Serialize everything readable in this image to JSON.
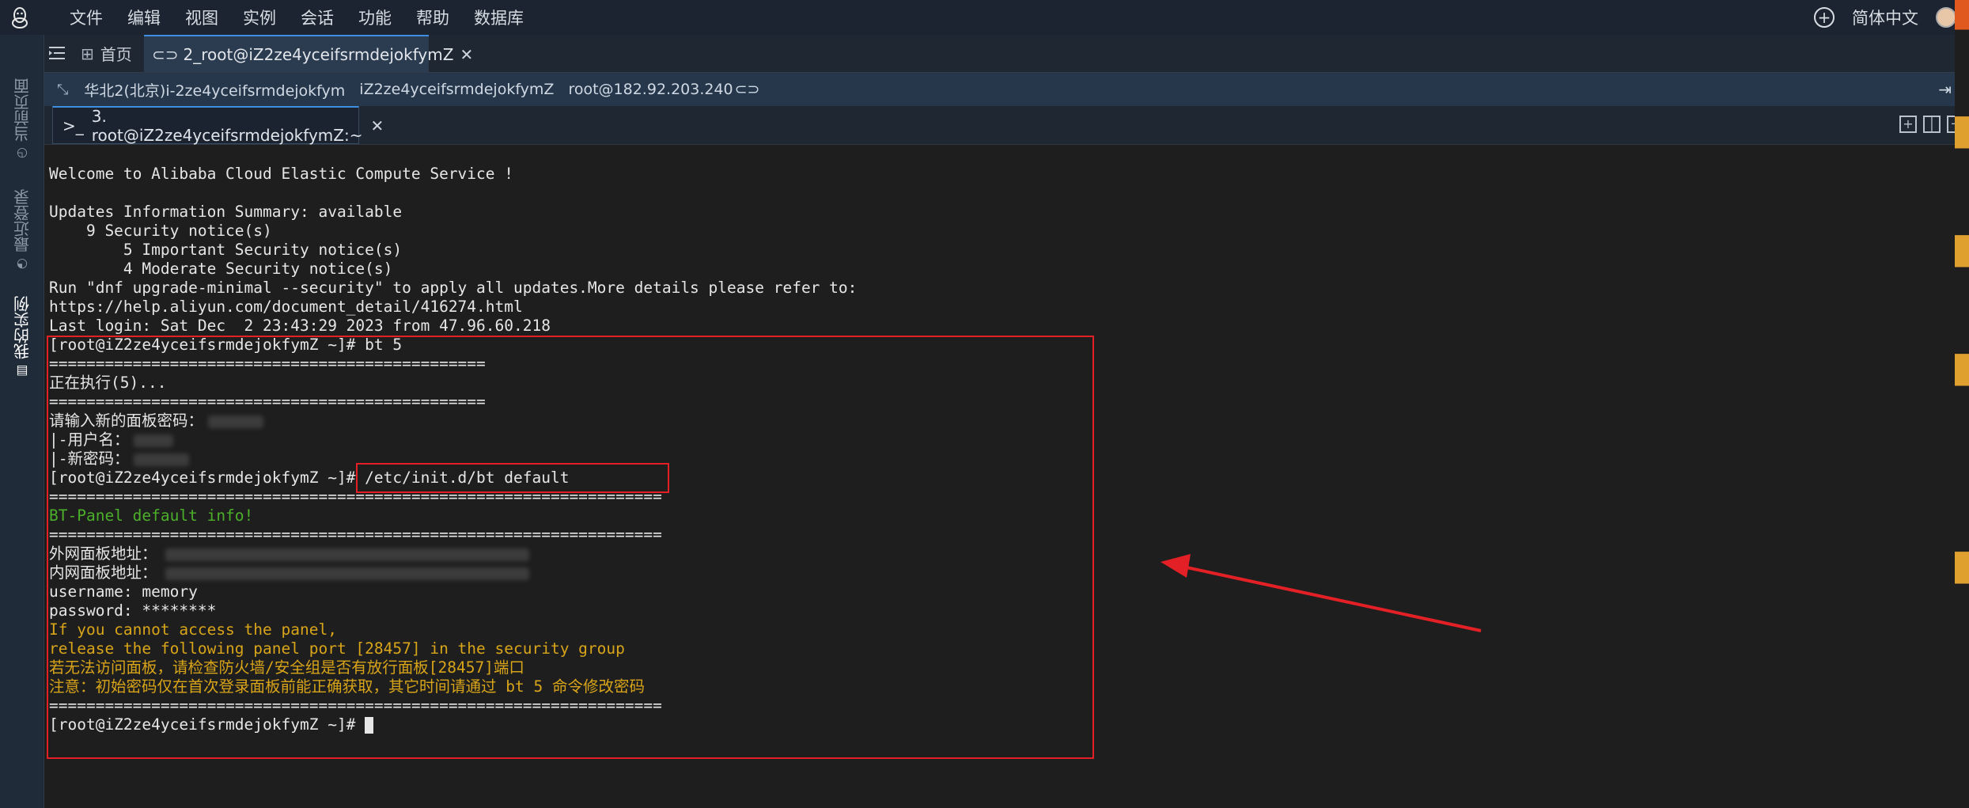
{
  "menubar": {
    "items": [
      "文件",
      "编辑",
      "视图",
      "实例",
      "会话",
      "功能",
      "帮助",
      "数据库"
    ],
    "language": "简体中文"
  },
  "sidebar": {
    "items": [
      {
        "label": "当前页面",
        "active": false
      },
      {
        "label": "最近登录",
        "active": false
      },
      {
        "label": "我的实例",
        "active": true
      }
    ]
  },
  "tabs": {
    "home_label": "首页",
    "session_tab_label": "2_root@iZ2ze4yceifsrmdejokfymZ"
  },
  "info": {
    "region": "华北2(北京)i-2ze4yceifsrmdejokfym",
    "hostname": "iZ2ze4yceifsrmdejokfymZ",
    "user_ip": "root@182.92.203.240"
  },
  "terminal_tab": {
    "label": "3. root@iZ2ze4yceifsrmdejokfymZ:~"
  },
  "terminal": {
    "lines": [
      "Welcome to Alibaba Cloud Elastic Compute Service !",
      "Updates Information Summary: available",
      "    9 Security notice(s)",
      "        5 Important Security notice(s)",
      "        4 Moderate Security notice(s)",
      "Run \"dnf upgrade-minimal --security\" to apply all updates.More details please refer to:",
      "https://help.aliyun.com/document_detail/416274.html",
      "Last login: Sat Dec  2 23:43:29 2023 from 47.96.60.218",
      "[root@iZ2ze4yceifsrmdejokfymZ ~]# bt 5",
      "===============================================",
      "正在执行(5)...",
      "===============================================",
      "请输入新的面板密码：",
      "|-用户名：",
      "|-新密码：",
      "[root@iZ2ze4yceifsrmdejokfymZ ~]# /etc/init.d/bt default",
      "==================================================================",
      "BT-Panel default info!",
      "==================================================================",
      "外网面板地址：",
      "内网面板地址：",
      "username: memory",
      "password: ********",
      "If you cannot access the panel,",
      "release the following panel port [28457] in the security group",
      "若无法访问面板，请检查防火墙/安全组是否有放行面板[28457]端口",
      "注意：初始密码仅在首次登录面板前能正确获取，其它时间请通过 bt 5 命令修改密码",
      "==================================================================",
      "[root@iZ2ze4yceifsrmdejokfymZ ~]# "
    ]
  },
  "colors": {
    "highlight_red": "#e32026",
    "terminal_green": "#4caf2a",
    "terminal_yellow": "#d8a419",
    "accent_blue": "#3f8fe0"
  },
  "icons": [
    "linux-penguin-icon",
    "plus-circle-icon",
    "avatar",
    "list-icon",
    "grid-icon",
    "link-icon",
    "close-icon",
    "expand-icon",
    "exit-icon",
    "prompt-icon",
    "split-add-icon",
    "split-vertical-icon",
    "split-horizontal-icon"
  ]
}
